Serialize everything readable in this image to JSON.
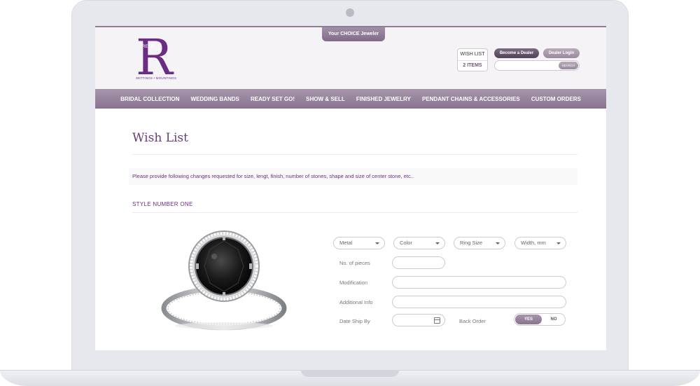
{
  "header": {
    "choice_tab": "Your CHOICE Jeweler",
    "logo_letter": "R",
    "logo_vertical": "REKO",
    "logo_tagline": "SETTINGS • MOUNTINGS",
    "wishlist": {
      "title": "WISH LIST",
      "count": "2 ITEMS"
    },
    "become_dealer": "Become a Dealer",
    "dealer_login": "Dealer Login",
    "search": {
      "placeholder": "",
      "button": "SEARCH"
    }
  },
  "nav": {
    "items": [
      "BRIDAL COLLECTION",
      "WEDDING BANDS",
      "READY SET GO!",
      "SHOW & SELL",
      "FINISHED JEWELRY",
      "PENDANT CHAINS & ACCESSORIES",
      "CUSTOM ORDERS"
    ]
  },
  "main": {
    "title": "Wish List",
    "notice": "Please provide following changes requested for size, lengt, finish, number of stones, shape and size of center stone, etc..",
    "style_heading": "STYLE NUMBER ONE",
    "selects": [
      "Metal",
      "Color",
      "Ring Size",
      "Width, mm"
    ],
    "labels": {
      "pieces": "No. of pieces",
      "modification": "Modification",
      "additional": "Additional Info",
      "date_ship": "Date Ship By",
      "back_order": "Back Order"
    },
    "toggle": {
      "yes": "YES",
      "no": "NO"
    }
  },
  "colors": {
    "brand": "#6b2d83",
    "nav": "#9a87a0",
    "header_bg": "#f6f3f7"
  }
}
